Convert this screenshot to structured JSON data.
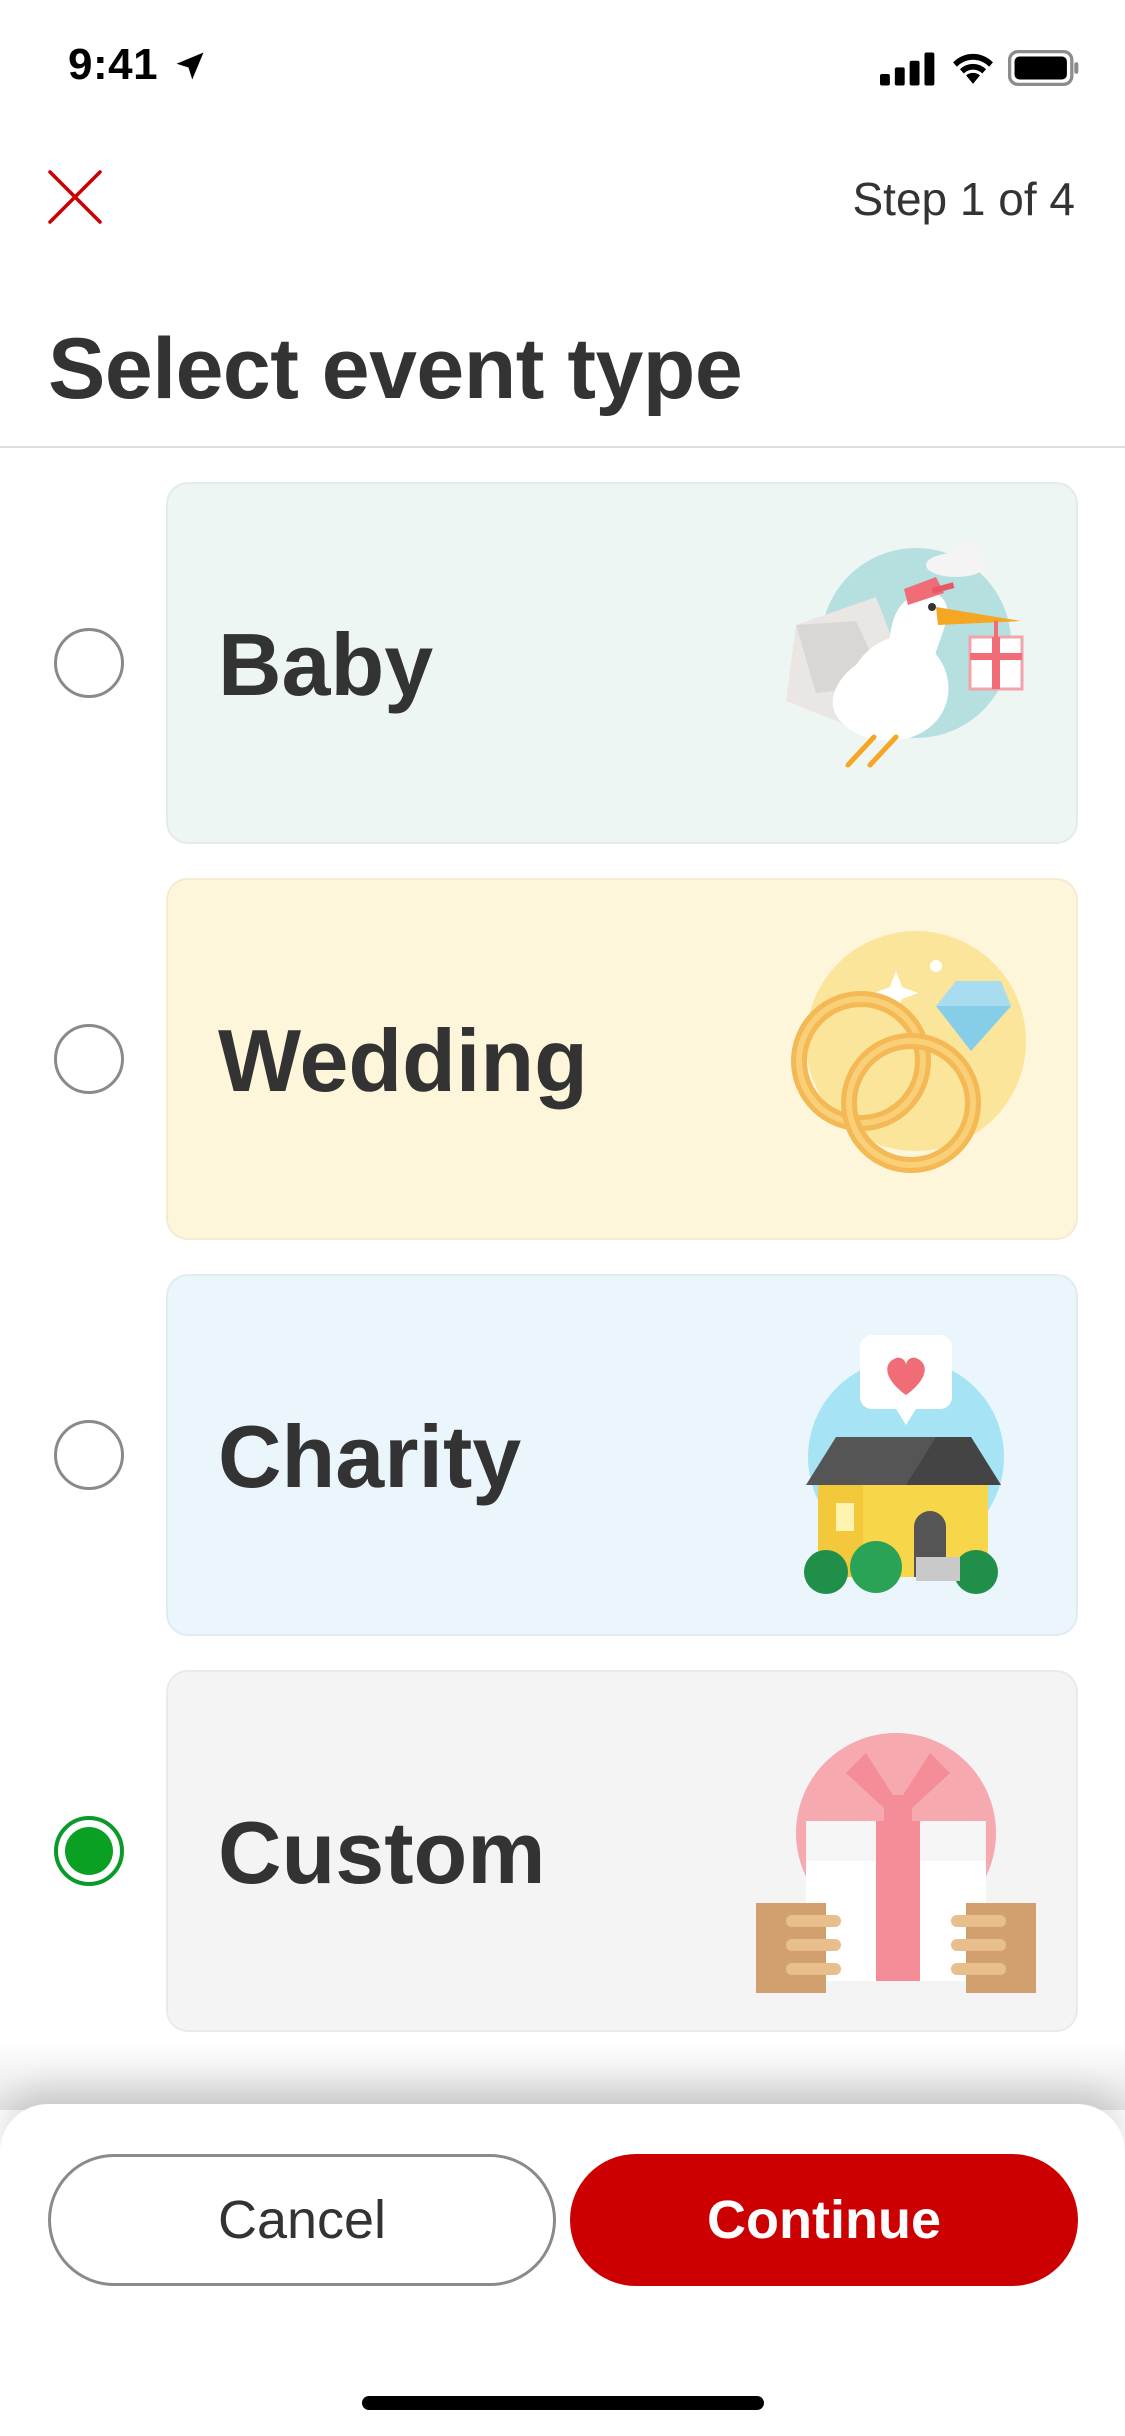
{
  "status_bar": {
    "time": "9:41",
    "icons": [
      "location-arrow-icon",
      "cellular-signal-icon",
      "wifi-icon",
      "battery-icon"
    ]
  },
  "header": {
    "close_icon": "close-icon",
    "step_text": "Step 1 of 4",
    "accent_color": "#cc0000"
  },
  "page": {
    "title": "Select event type"
  },
  "options": [
    {
      "label": "Baby",
      "selected": false,
      "card_color": "#eef6f4",
      "art_icon": "stork-icon"
    },
    {
      "label": "Wedding",
      "selected": false,
      "card_color": "#fdf6da",
      "art_icon": "wedding-rings-icon"
    },
    {
      "label": "Charity",
      "selected": false,
      "card_color": "#eaf6fc",
      "art_icon": "charity-house-icon"
    },
    {
      "label": "Custom",
      "selected": true,
      "card_color": "#f4f4f4",
      "art_icon": "gift-box-icon"
    }
  ],
  "footer": {
    "cancel_label": "Cancel",
    "continue_label": "Continue",
    "continue_color": "#cc0000",
    "selected_color": "#0aa023"
  }
}
